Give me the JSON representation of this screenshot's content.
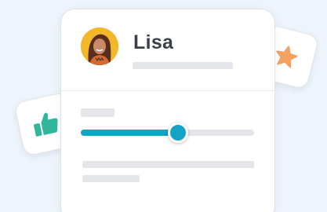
{
  "profile": {
    "name": "Lisa",
    "avatar_icon": "person-avatar",
    "avatar_bg_color": "#f3b72a"
  },
  "rating": {
    "slider_value_percent": 56,
    "accent_color": "#14a2c7"
  },
  "floating_icons": {
    "left": "thumbs-up-icon",
    "left_color": "#2fb69b",
    "right": "star-icon",
    "right_color": "#f4a261"
  }
}
